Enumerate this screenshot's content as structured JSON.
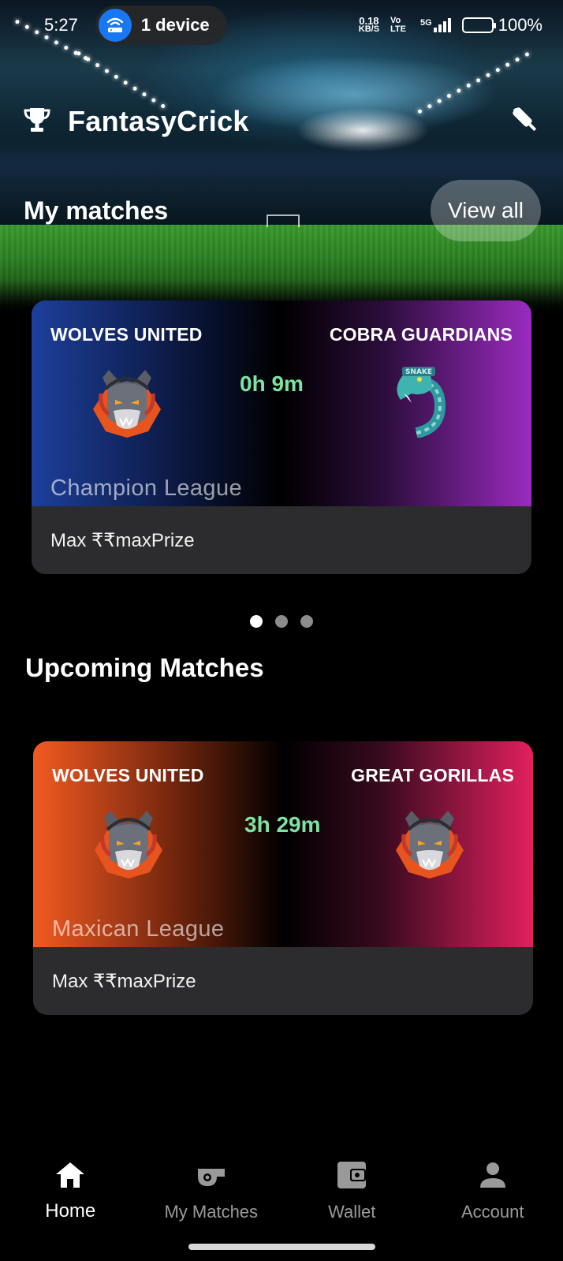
{
  "status_bar": {
    "time": "5:27",
    "device_pill": "1 device",
    "net_speed_value": "0.18",
    "net_speed_unit": "KB/S",
    "volte": "Vo LTE",
    "signal": "5G",
    "battery": "100%"
  },
  "app": {
    "title": "FantasyCrick",
    "trophy_icon": "trophy-icon",
    "bat_icon": "cricket-bat-icon"
  },
  "my_matches": {
    "title": "My matches",
    "view_all_label": "View all",
    "cards": [
      {
        "team_left": "WOLVES UNITED",
        "team_right": "COBRA GUARDIANS",
        "countdown": "0h 9m",
        "league": "Champion League",
        "prize": "Max ₹₹maxPrize",
        "colors": {
          "left": "#1d3f9c",
          "right": "#9a2bc0"
        }
      }
    ],
    "carousel_dots": 3,
    "active_dot": 0
  },
  "upcoming": {
    "title": "Upcoming Matches",
    "cards": [
      {
        "team_left": "WOLVES UNITED",
        "team_right": "GREAT GORILLAS",
        "countdown": "3h 29m",
        "league": "Maxican League",
        "prize": "Max ₹₹maxPrize",
        "colors": {
          "left": "#f35a22",
          "right": "#e2205e"
        }
      }
    ]
  },
  "bottom_nav": {
    "items": [
      {
        "label": "Home",
        "icon": "home-icon",
        "active": true
      },
      {
        "label": "My Matches",
        "icon": "whistle-icon",
        "active": false
      },
      {
        "label": "Wallet",
        "icon": "wallet-icon",
        "active": false
      },
      {
        "label": "Account",
        "icon": "person-icon",
        "active": false
      }
    ]
  }
}
